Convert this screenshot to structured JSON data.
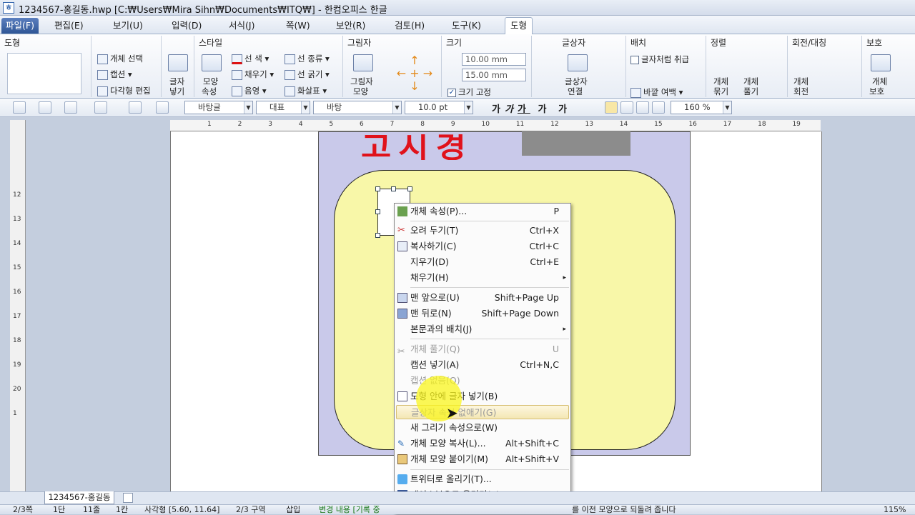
{
  "window": {
    "title": "1234567-홍길동.hwp [C:₩Users₩Mira Sihn₩Documents₩ITQ₩] - 한컴오피스 한글",
    "icon": "hwp-doc-icon"
  },
  "menubar": {
    "items": [
      "파일(F)",
      "편집(E)",
      "보기(U)",
      "입력(D)",
      "서식(J)",
      "쪽(W)",
      "보안(R)",
      "검토(H)",
      "도구(K)"
    ],
    "active_tab": "도형"
  },
  "ribbon": {
    "shape": {
      "title": "도형",
      "select": "개체 선택",
      "caption": "캡션",
      "polygon_edit": "다각형 편집"
    },
    "text_insert": {
      "label1": "글자",
      "label2": "넣기"
    },
    "style": {
      "title": "스타일",
      "props1": "모양",
      "props2": "속성",
      "line_color": "선 색",
      "fill": "채우기",
      "shade": "음영",
      "line_type": "선 종류",
      "line_width": "선 굵기",
      "arrow": "화살표"
    },
    "shadow": {
      "title": "그림자",
      "label1": "그림자",
      "label2": "모양"
    },
    "size": {
      "title": "크기",
      "width": "10.00",
      "height": "15.00",
      "unit": "mm",
      "fix": "크기 고정",
      "fix_checked": true
    },
    "textbox": {
      "title": "글상자",
      "link1": "글상자",
      "link2": "연결"
    },
    "arrange": {
      "title": "배치",
      "as_char": "글자처럼 취급",
      "margin": "바깥 여백"
    },
    "align": {
      "title": "정렬",
      "group1": "개체",
      "group2": "묶기",
      "ungroup1": "개체",
      "ungroup2": "풀기"
    },
    "rotate": {
      "title": "회전/대칭",
      "rot1": "개체",
      "rot2": "회전"
    },
    "protect": {
      "title": "보호",
      "p1": "개체",
      "p2": "보호"
    }
  },
  "format": {
    "style": "바탕글",
    "lang": "대표",
    "font": "바탕",
    "size": "10.0",
    "size_unit": "pt",
    "bold": "가",
    "italic": "가",
    "underline": "가",
    "strike": "가",
    "color": "가",
    "line_spacing": "160",
    "spacing_unit": "%"
  },
  "ruler": {
    "ticks": [
      "1",
      "2",
      "3",
      "4",
      "5",
      "6",
      "7",
      "8",
      "9",
      "10",
      "11",
      "12",
      "13",
      "14",
      "15",
      "16",
      "17",
      "18",
      "19"
    ],
    "vticks": [
      "1",
      "12",
      "13",
      "14",
      "15",
      "16",
      "17",
      "18",
      "19",
      "20"
    ]
  },
  "document": {
    "red_text": "고시경",
    "colors": {
      "lavender": "#c9c9ea",
      "yellow": "#f8f7a8",
      "red": "#e0121b"
    }
  },
  "context_menu": {
    "items": [
      {
        "label": "개체 속성(P)...",
        "shortcut": "P",
        "icon": "object-props-icon"
      },
      {
        "label": "오려 두기(T)",
        "shortcut": "Ctrl+X",
        "icon": "scissors-icon"
      },
      {
        "label": "복사하기(C)",
        "shortcut": "Ctrl+C",
        "icon": "copy-icon"
      },
      {
        "label": "지우기(D)",
        "shortcut": "Ctrl+E"
      },
      {
        "label": "채우기(H)",
        "shortcut": "▸"
      },
      {
        "label": "맨 앞으로(U)",
        "shortcut": "Shift+Page Up",
        "icon": "bring-front-icon"
      },
      {
        "label": "맨 뒤로(N)",
        "shortcut": "Shift+Page Down",
        "icon": "send-back-icon"
      },
      {
        "label": "본문과의 배치(J)",
        "shortcut": "▸"
      },
      {
        "label": "개체 풀기(Q)",
        "shortcut": "U",
        "icon": "ungroup-icon",
        "disabled": true
      },
      {
        "label": "캡션 넣기(A)",
        "shortcut": "Ctrl+N,C"
      },
      {
        "label": "캡션 없음(Q)",
        "shortcut": "",
        "disabled": true
      },
      {
        "label": "도형 안에 글자 넣기(B)",
        "shortcut": "",
        "icon": "text-in-shape-icon"
      },
      {
        "label": "글상자 속성 없애기(G)",
        "shortcut": "",
        "disabled": true,
        "hover": true
      },
      {
        "label": "새 그리기 속성으로(W)",
        "shortcut": ""
      },
      {
        "label": "개체 모양 복사(L)...",
        "shortcut": "Alt+Shift+C",
        "icon": "brush-icon"
      },
      {
        "label": "개체 모양 붙이기(M)",
        "shortcut": "Alt+Shift+V",
        "icon": "paste-icon"
      },
      {
        "label": "트위터로 올리기(T)...",
        "shortcut": "",
        "icon": "twitter-icon"
      },
      {
        "label": "페이스북으로 올리기(E)",
        "shortcut": "",
        "icon": "facebook-icon"
      }
    ]
  },
  "tabs": {
    "doc": "1234567-홍길동"
  },
  "status": {
    "page": "2/3쪽",
    "section": "1단",
    "line": "11줄",
    "col": "1칸",
    "shape": "사각형 [5.60, 11.64]",
    "region": "2/3 구역",
    "mode": "삽입",
    "changes": "변경 내용 [기록 중",
    "hint": "를 이전 모양으로 되돌려 줍니다",
    "zoom": "115%"
  }
}
